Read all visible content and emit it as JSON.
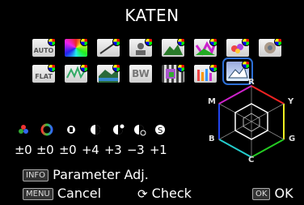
{
  "title": "KATEN",
  "icons": {
    "row1": [
      {
        "name": "auto-icon",
        "label": "AUTO"
      },
      {
        "name": "natural-icon"
      },
      {
        "name": "tone-curve-icon"
      },
      {
        "name": "portrait-icon"
      },
      {
        "name": "landscape-icon"
      },
      {
        "name": "vibrant-icon"
      },
      {
        "name": "flower-icon"
      },
      {
        "name": "muted-icon"
      }
    ],
    "row2": [
      {
        "name": "flat-icon",
        "label": "FLAT"
      },
      {
        "name": "forest-icon"
      },
      {
        "name": "river-icon"
      },
      {
        "name": "bw-icon",
        "label": "BW"
      },
      {
        "name": "bleach-bypass-icon"
      },
      {
        "name": "reversal-film-icon"
      },
      {
        "name": "cross-process-icon"
      }
    ]
  },
  "hex_labels": {
    "r": "R",
    "y": "Y",
    "g": "G",
    "c": "C",
    "b": "B",
    "m": "M"
  },
  "params": [
    {
      "name": "saturation-param",
      "value": "±0",
      "color": "#e33"
    },
    {
      "name": "hue-param",
      "value": "±0",
      "color": "#f90"
    },
    {
      "name": "high-low-key-param",
      "value": "±0",
      "color": "#ddd"
    },
    {
      "name": "contrast-param",
      "value": "+4",
      "color": "#ddd"
    },
    {
      "name": "contrast-highlight-param",
      "value": "+3",
      "color": "#ddd"
    },
    {
      "name": "contrast-shadow-param",
      "value": "−3",
      "color": "#ddd"
    },
    {
      "name": "sharpness-param",
      "value": "+1",
      "color": "#ddd"
    }
  ],
  "bottom": {
    "info_btn": "INFO",
    "info_text": "Parameter Adj.",
    "menu_btn": "MENU",
    "menu_text": "Cancel",
    "check_text": "Check",
    "ok_btn": "OK",
    "ok_text": "OK"
  }
}
